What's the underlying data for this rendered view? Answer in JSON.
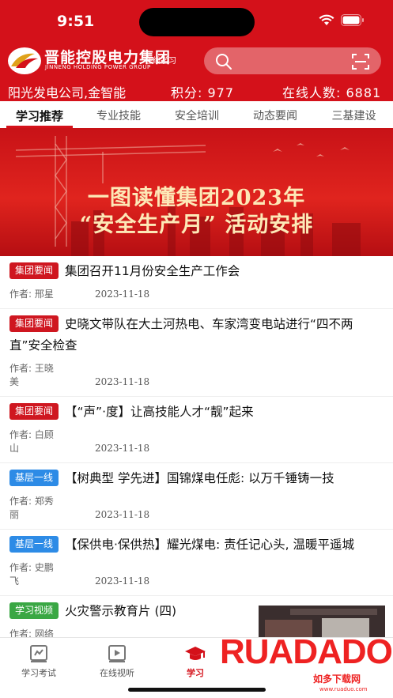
{
  "status": {
    "time": "9:51"
  },
  "brand": {
    "name": "晋能控股电力集团",
    "name_en": "JINNENG HOLDING POWER GROUP",
    "tag": "在线学习"
  },
  "search": {
    "placeholder": ""
  },
  "info": {
    "unit": "阳光发电公司,金智能",
    "points": "积分: 977",
    "online": "在线人数: 6881"
  },
  "tabs": [
    {
      "label": "学习推荐"
    },
    {
      "label": "专业技能"
    },
    {
      "label": "安全培训"
    },
    {
      "label": "动态要闻"
    },
    {
      "label": "三基建设"
    }
  ],
  "banner": {
    "line1": "一图读懂集团2023年",
    "line2": "“安全生产月” 活动安排"
  },
  "news": [
    {
      "tag": "集团要闻",
      "tag_color": "#cf1720",
      "title": "集团召开11月份安全生产工作会",
      "author": "作者: 邢星",
      "date": "2023-11-18"
    },
    {
      "tag": "集团要闻",
      "tag_color": "#cf1720",
      "title": "史晓文带队在大土河热电、车家湾变电站进行“四不两直”安全检查",
      "author": "作者: 王晓美",
      "date": "2023-11-18"
    },
    {
      "tag": "集团要闻",
      "tag_color": "#cf1720",
      "title": "【“声”·度】让高技能人才“靓”起来",
      "author": "作者: 白顾山",
      "date": "2023-11-18"
    },
    {
      "tag": "基层一线",
      "tag_color": "#2d8be6",
      "title": "【树典型 学先进】国锦煤电任彪: 以万千锤铸一技",
      "author": "作者: 郑秀丽",
      "date": "2023-11-18"
    },
    {
      "tag": "基层一线",
      "tag_color": "#2d8be6",
      "title": "【保供电·保供热】耀光煤电: 责任记心头, 温暖平遥城",
      "author": "作者: 史鹏飞",
      "date": "2023-11-18"
    },
    {
      "tag": "学习视频",
      "tag_color": "#3aa744",
      "title": "火灾警示教育片 (四)",
      "author": "作者: 网络",
      "date": ""
    }
  ],
  "bottom_nav": [
    {
      "label": "学习考试",
      "icon": "exam-icon"
    },
    {
      "label": "在线视听",
      "icon": "video-icon"
    },
    {
      "label": "学习",
      "icon": "graduation-cap-icon"
    }
  ],
  "watermark": {
    "main": "RUADADO",
    "sub": "如多下载网",
    "url": "www.ruaduo.com"
  },
  "colors": {
    "primary": "#d4111a",
    "badge_red": "#cf1720",
    "badge_blue": "#2d8be6",
    "badge_green": "#3aa744"
  }
}
